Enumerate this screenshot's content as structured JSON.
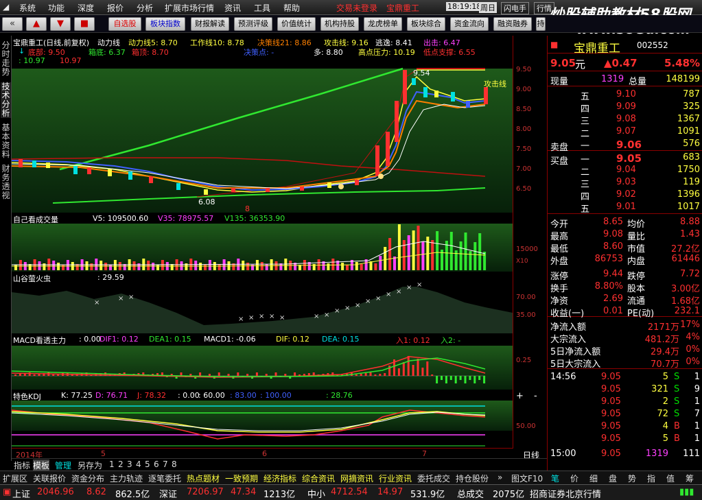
{
  "menu": [
    "系统",
    "功能",
    "深度",
    "报价",
    "分析",
    "扩展市场行情",
    "资讯",
    "工具",
    "帮助"
  ],
  "menu_status": {
    "notice": "交易未登录",
    "stock": "宝鼎重工",
    "time": "18:19:18",
    "day": "周日",
    "flash": "闪电手",
    "quote": "行情"
  },
  "watermark": {
    "line1": "炒股辅助教材58股网",
    "line2": "www.58Gu.com"
  },
  "toolbar": [
    "自选股",
    "板块指数",
    "财报解读",
    "预测评级",
    "价值统计",
    "机构持股",
    "龙虎榜单",
    "板块综合",
    "资金流向",
    "融资融券",
    "持"
  ],
  "left_tabs": [
    "分时走势",
    "技术分析",
    "基本资料",
    "财务透视"
  ],
  "main": {
    "title": "宝鼎重工(日线,前复权)",
    "ind": "动力线",
    "dl": "动力线5: 8.70",
    "gz": "工作线10: 8.78",
    "jc": "决策线21: 8.86",
    "gj": "攻击线: 9.16",
    "ty": "逃逸: 8.41",
    "ch": "出击: 6.47",
    "ds": "底部: 9.50",
    "fd": "箱底: 6.37",
    "xd": "箱顶: 8.70",
    "jcd": "决策点: -",
    "duo": "多: 8.80",
    "gdyl": "高点压力: 10.19",
    "ddzc": "低点支撑: 6.55",
    "v1": ": 10.97",
    "v2": "10.97",
    "hi": "9.54",
    "lo": "6.08",
    "attack": "攻击线",
    "mark8": "8"
  },
  "main_y": [
    "9.50",
    "9.00",
    "8.50",
    "8.00",
    "7.50",
    "7.00",
    "6.50"
  ],
  "vol": {
    "title": "自己看成交量",
    "v5": "V5: 109500.60",
    "v35": "V35: 78975.57",
    "v135": "V135: 36353.90",
    "y": "15000",
    "unit": "X10"
  },
  "firefly": {
    "title": "山谷萤火虫",
    "val": ": 29.59",
    "y1": "70.00",
    "y2": "35.00"
  },
  "macd": {
    "title": "MACD看透主力",
    "v0": ": 0.00",
    "dif1": "DIF1: 0.12",
    "dea1": "DEA1: 0.15",
    "macd1": "MACD1: -0.06",
    "dif": "DIF: 0.12",
    "dea": "DEA: 0.15",
    "r1": "入1: 0.12",
    "r2": "入2: -",
    "y": "0.25"
  },
  "kdj": {
    "title": "特色KDJ",
    "k": "K: 77.25",
    "d": "D: 76.71",
    "j": "J: 78.32",
    "a": ": 0.00",
    "b": ": 60.00",
    "c": ": 83.00",
    "e": ": 100.00",
    "f": ": 28.76",
    "y": "50.00"
  },
  "dates": {
    "d0": "2014年",
    "d1": "5",
    "d2": "6",
    "d3": "7",
    "day": "日线",
    "plus": "+",
    "minus": "-"
  },
  "ind_tabs": [
    "指标",
    "模板",
    "管理",
    "另存为",
    "1",
    "2",
    "3",
    "4",
    "5",
    "6",
    "7",
    "8"
  ],
  "stock": {
    "name": "宝鼎重工",
    "code": "002552",
    "price": "9.05",
    "unit": "元",
    "chg": "▲0.47",
    "pct": "5.48%",
    "cur_label": "现量",
    "cur": "1319",
    "tot_label": "总量",
    "tot": "148199"
  },
  "sell": [
    {
      "l": "五",
      "p": "9.10",
      "v": "787"
    },
    {
      "l": "四",
      "p": "9.09",
      "v": "325"
    },
    {
      "l": "三",
      "p": "9.08",
      "v": "1367"
    },
    {
      "l": "二",
      "p": "9.07",
      "v": "1091"
    },
    {
      "l": "一",
      "p": "9.06",
      "v": "576"
    }
  ],
  "buy": [
    {
      "l": "一",
      "p": "9.05",
      "v": "683"
    },
    {
      "l": "二",
      "p": "9.04",
      "v": "1750"
    },
    {
      "l": "三",
      "p": "9.03",
      "v": "119"
    },
    {
      "l": "四",
      "p": "9.02",
      "v": "1396"
    },
    {
      "l": "五",
      "p": "9.01",
      "v": "1017"
    }
  ],
  "sell_label": "卖盘",
  "buy_label": "买盘",
  "stats": [
    {
      "a": "今开",
      "av": "8.65",
      "b": "均价",
      "bv": "8.88"
    },
    {
      "a": "最高",
      "av": "9.08",
      "b": "量比",
      "bv": "1.43"
    },
    {
      "a": "最低",
      "av": "8.60",
      "b": "市值",
      "bv": "27.2亿"
    },
    {
      "a": "外盘",
      "av": "86753",
      "b": "内盘",
      "bv": "61446"
    },
    {
      "a": "涨停",
      "av": "9.44",
      "b": "跌停",
      "bv": "7.72"
    },
    {
      "a": "换手",
      "av": "8.80%",
      "b": "股本",
      "bv": "3.00亿"
    },
    {
      "a": "净资",
      "av": "2.69",
      "b": "流通",
      "bv": "1.68亿"
    },
    {
      "a": "收益(一)",
      "av": "0.01",
      "b": "PE(动)",
      "bv": "232.1"
    }
  ],
  "flow": [
    {
      "l": "净流入额",
      "v": "2171万",
      "p": "17%"
    },
    {
      "l": "大宗流入",
      "v": "481.2万",
      "p": "4%"
    },
    {
      "l": "5日净流入额",
      "v": "29.4万",
      "p": "0%"
    },
    {
      "l": "5日大宗流入",
      "v": "70.7万",
      "p": "0%"
    }
  ],
  "ticks": [
    {
      "t": "14:56",
      "p": "9.05",
      "v": "5",
      "s": "S",
      "n": "1"
    },
    {
      "t": "",
      "p": "9.05",
      "v": "321",
      "s": "S",
      "n": "9"
    },
    {
      "t": "",
      "p": "9.05",
      "v": "2",
      "s": "S",
      "n": "1"
    },
    {
      "t": "",
      "p": "9.05",
      "v": "72",
      "s": "S",
      "n": "7"
    },
    {
      "t": "",
      "p": "9.05",
      "v": "4",
      "s": "B",
      "n": "1"
    },
    {
      "t": "",
      "p": "9.05",
      "v": "5",
      "s": "B",
      "n": "1"
    },
    {
      "t": "15:00",
      "p": "9.05",
      "v": "1319",
      "s": "",
      "n": "111"
    }
  ],
  "right_tabs": [
    "笔",
    "价",
    "细",
    "盘",
    "势",
    "指",
    "值",
    "筹"
  ],
  "bottom": [
    "扩展区",
    "关联报价",
    "资金分布",
    "主力轨迹",
    "逐笔委托",
    "热点题材",
    "一致预期",
    "经济指标",
    "综合资讯",
    "网摘资讯",
    "行业资讯",
    "委托成交",
    "持仓股份"
  ],
  "bottom_right": "图文F10",
  "status": {
    "sh": "上证",
    "shv": "2046.96",
    "shc": "8.62",
    "sha": "862.5亿",
    "sz": "深证",
    "szv": "7206.97",
    "szc": "47.34",
    "sza": "1213亿",
    "zx": "中小",
    "zxv": "4712.54",
    "zxc": "14.97",
    "zxa": "531.9亿",
    "tot": "总成交",
    "tota": "2075亿",
    "broker": "招商证券北京行情"
  }
}
